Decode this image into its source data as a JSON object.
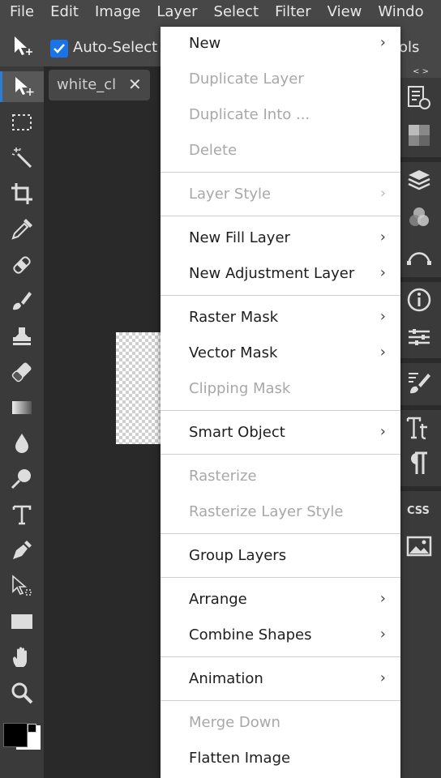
{
  "menubar": {
    "items": [
      "File",
      "Edit",
      "Image",
      "Layer",
      "Select",
      "Filter",
      "View",
      "Windo"
    ]
  },
  "options_bar": {
    "auto_select_label": "Auto-Select",
    "auto_select_checked": true,
    "right_text": "ols"
  },
  "document": {
    "tab_label": "white_cl",
    "close_glyph": "✕"
  },
  "right_panel": {
    "collapse_arrows": "< >"
  },
  "layer_menu": {
    "items": [
      {
        "label": "New",
        "disabled": false,
        "submenu": true
      },
      {
        "label": "Duplicate Layer",
        "disabled": true,
        "submenu": false
      },
      {
        "label": "Duplicate Into ...",
        "disabled": true,
        "submenu": false
      },
      {
        "label": "Delete",
        "disabled": true,
        "submenu": false
      },
      {
        "label": "Layer Style",
        "disabled": true,
        "submenu": true
      },
      {
        "label": "New Fill Layer",
        "disabled": false,
        "submenu": true
      },
      {
        "label": "New Adjustment Layer",
        "disabled": false,
        "submenu": true
      },
      {
        "label": "Raster Mask",
        "disabled": false,
        "submenu": true
      },
      {
        "label": "Vector Mask",
        "disabled": false,
        "submenu": true
      },
      {
        "label": "Clipping Mask",
        "disabled": true,
        "submenu": false
      },
      {
        "label": "Smart Object",
        "disabled": false,
        "submenu": true
      },
      {
        "label": "Rasterize",
        "disabled": true,
        "submenu": false
      },
      {
        "label": "Rasterize Layer Style",
        "disabled": true,
        "submenu": false
      },
      {
        "label": "Group Layers",
        "disabled": false,
        "submenu": false
      },
      {
        "label": "Arrange",
        "disabled": false,
        "submenu": true
      },
      {
        "label": "Combine Shapes",
        "disabled": false,
        "submenu": true
      },
      {
        "label": "Animation",
        "disabled": false,
        "submenu": true
      },
      {
        "label": "Merge Down",
        "disabled": true,
        "submenu": false
      },
      {
        "label": "Flatten Image",
        "disabled": false,
        "submenu": false
      }
    ],
    "arrow_glyph": "›"
  },
  "tools": [
    "move-icon",
    "marquee-icon",
    "magic-wand-icon",
    "crop-icon",
    "eyedropper-icon",
    "healing-brush-icon",
    "brush-icon",
    "stamp-icon",
    "eraser-icon",
    "gradient-icon",
    "blur-icon",
    "dodge-icon",
    "type-icon",
    "pen-icon",
    "path-select-icon",
    "rectangle-icon",
    "hand-icon",
    "zoom-icon"
  ],
  "colors": {
    "accent": "#1a73e8",
    "foreground": "#000000",
    "background": "#ffffff"
  }
}
